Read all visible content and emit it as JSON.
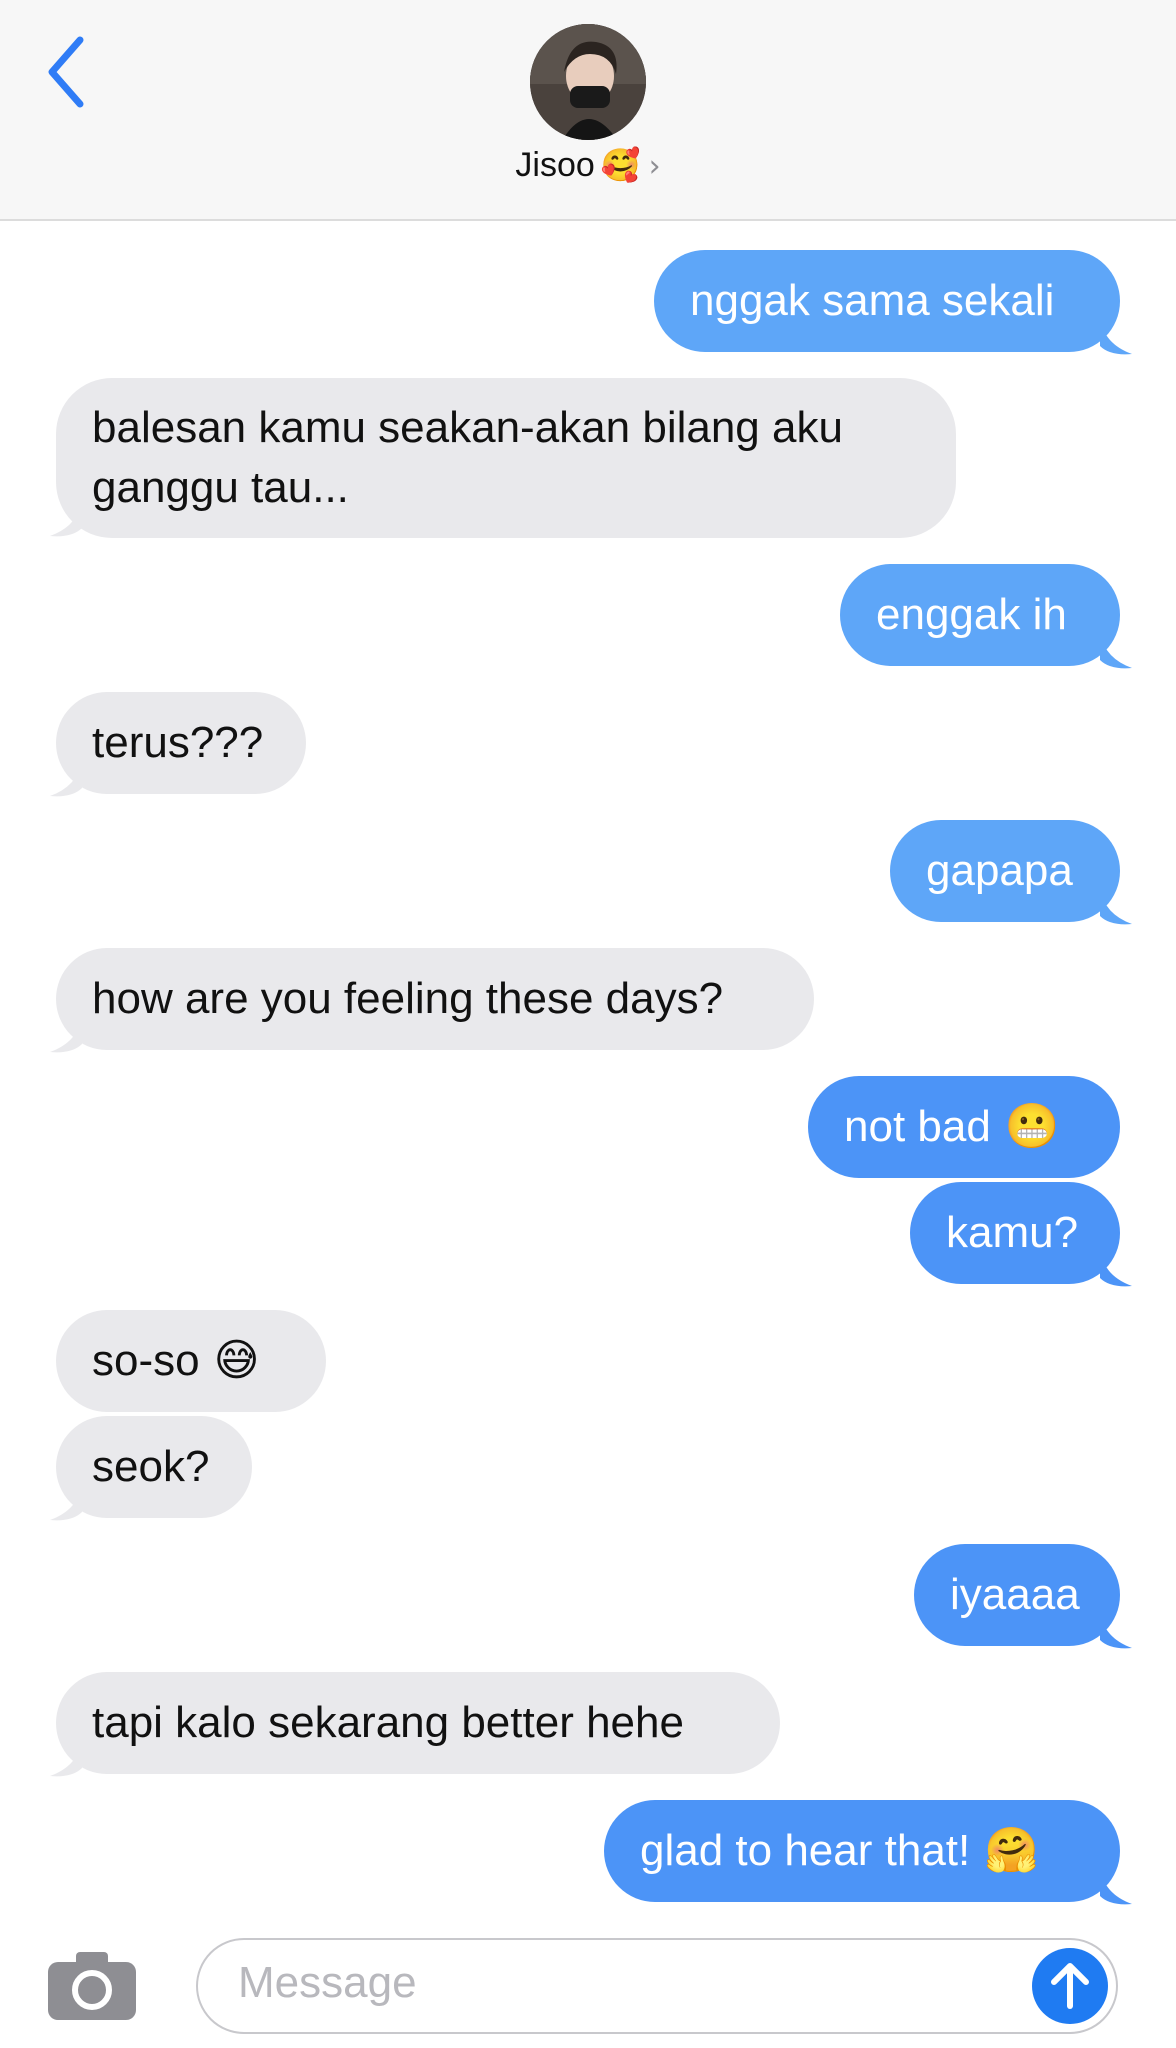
{
  "header": {
    "contact_name": "Jisoo",
    "contact_emoji": "🥰",
    "chevron": "›"
  },
  "messages": [
    {
      "side": "outgoing",
      "text": "nggak sama sekali"
    },
    {
      "side": "incoming",
      "text": "balesan kamu seakan-akan bilang aku ganggu tau...",
      "lines": [
        "balesan kamu seakan-akan bilang aku",
        "ganggu tau..."
      ]
    },
    {
      "side": "outgoing",
      "text": "enggak ih"
    },
    {
      "side": "incoming",
      "text": "terus???"
    },
    {
      "side": "outgoing",
      "text": "gapapa"
    },
    {
      "side": "incoming",
      "text": "how are you feeling these days?"
    },
    {
      "side": "outgoing",
      "text": "not bad",
      "emoji": "😬"
    },
    {
      "side": "outgoing",
      "text": "kamu?"
    },
    {
      "side": "incoming",
      "text": "so-so",
      "emoji": "😅"
    },
    {
      "side": "incoming",
      "text": "seok?"
    },
    {
      "side": "outgoing",
      "text": "iyaaaa"
    },
    {
      "side": "incoming",
      "text": "tapi kalo sekarang better hehe"
    },
    {
      "side": "outgoing",
      "text": "glad to hear that!",
      "emoji": "🤗"
    }
  ],
  "composer": {
    "placeholder": "Message"
  },
  "colors": {
    "outgoing": "#4c94f7",
    "incoming": "#e9e9ec",
    "accent": "#1f7bf2"
  },
  "icons": [
    "back-chevron-icon",
    "camera-icon",
    "send-arrow-icon"
  ]
}
